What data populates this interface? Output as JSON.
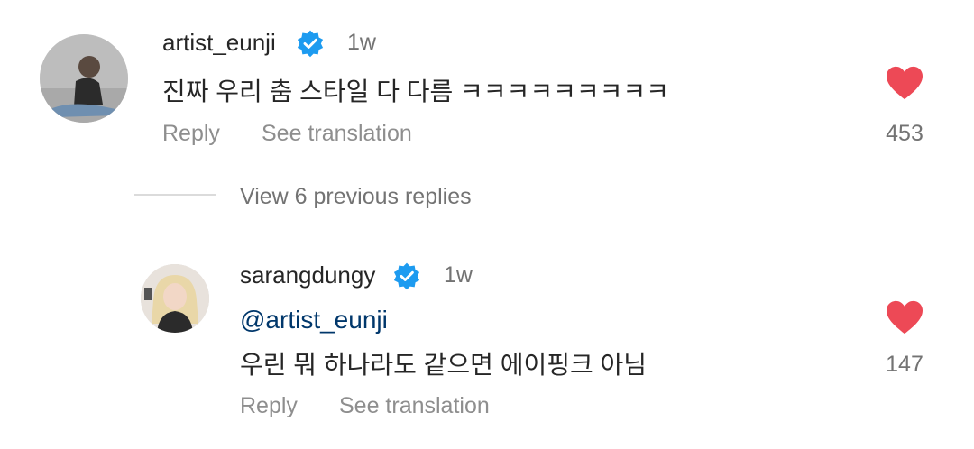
{
  "colors": {
    "heart": "#ed4956",
    "verified": "#1d9bf0",
    "mention": "#00376b",
    "secondary_text": "#8e8e8e"
  },
  "comment1": {
    "username": "artist_eunji",
    "time": "1w",
    "text": "진짜 우리 춤 스타일 다 다름 ㅋㅋㅋㅋㅋㅋㅋㅋㅋ",
    "reply_label": "Reply",
    "translate_label": "See translation",
    "like_count": "453",
    "icons": {
      "verified": "verified-badge-icon",
      "heart": "heart-filled-icon"
    }
  },
  "view_replies_label": "View 6 previous replies",
  "comment2": {
    "username": "sarangdungy",
    "time": "1w",
    "mention": "@artist_eunji",
    "text": "우린 뭐 하나라도 같으면 에이핑크 아님",
    "reply_label": "Reply",
    "translate_label": "See translation",
    "like_count": "147",
    "icons": {
      "verified": "verified-badge-icon",
      "heart": "heart-filled-icon"
    }
  }
}
